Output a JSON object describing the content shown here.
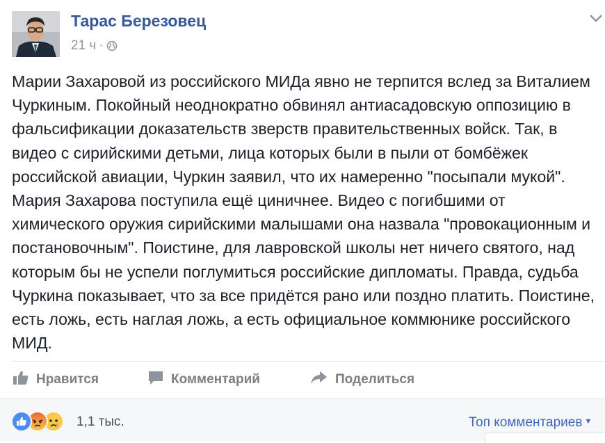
{
  "post": {
    "author": "Тарас Березовец",
    "time": "21 ч",
    "separator": "·",
    "privacy_icon": "globe-icon",
    "menu_icon": "chevron-down-icon",
    "text": "Марии Захаровой из российского МИДа явно не терпится вслед за Виталием Чуркиным. Покойный неоднократно обвинял антиасадовскую оппозицию в фальсификации доказательств зверств правительственных войск. Так, в видео с сирийскими детьми, лица которых были в пыли от бомбёжек российской авиации, Чуркин заявил, что их намеренно \"посыпали мукой\". Мария Захарова поступила ещё циничнее. Видео с погибшими от химического оружия сирийскими малышами она назвала \"провокационным и постановочным\". Поистине, для лавровской школы нет ничего святого, над которым бы не успели поглумиться российские дипломаты. Правда, судьба Чуркина показывает, что за все придётся рано или поздно платить. Поистине, есть ложь, есть наглая ложь, а есть официальное коммюнике российского МИД."
  },
  "actions": {
    "like_label": "Нравится",
    "like_icon": "thumbs-up-icon",
    "comment_label": "Комментарий",
    "comment_icon": "speech-bubble-icon",
    "share_label": "Поделиться",
    "share_icon": "share-arrow-icon"
  },
  "footer": {
    "reactions": [
      "like-icon",
      "angry-icon",
      "sad-icon"
    ],
    "reaction_count": "1,1 тыс.",
    "sort_label": "Топ комментариев",
    "sort_caret": "▼"
  },
  "colors": {
    "link": "#365899",
    "action_gray": "#7f7f7f",
    "sort_blue": "#4267b2",
    "like_blue": "#4f8bf5",
    "angry_red": "#f0643c",
    "sad_yellow": "#f7c948"
  }
}
